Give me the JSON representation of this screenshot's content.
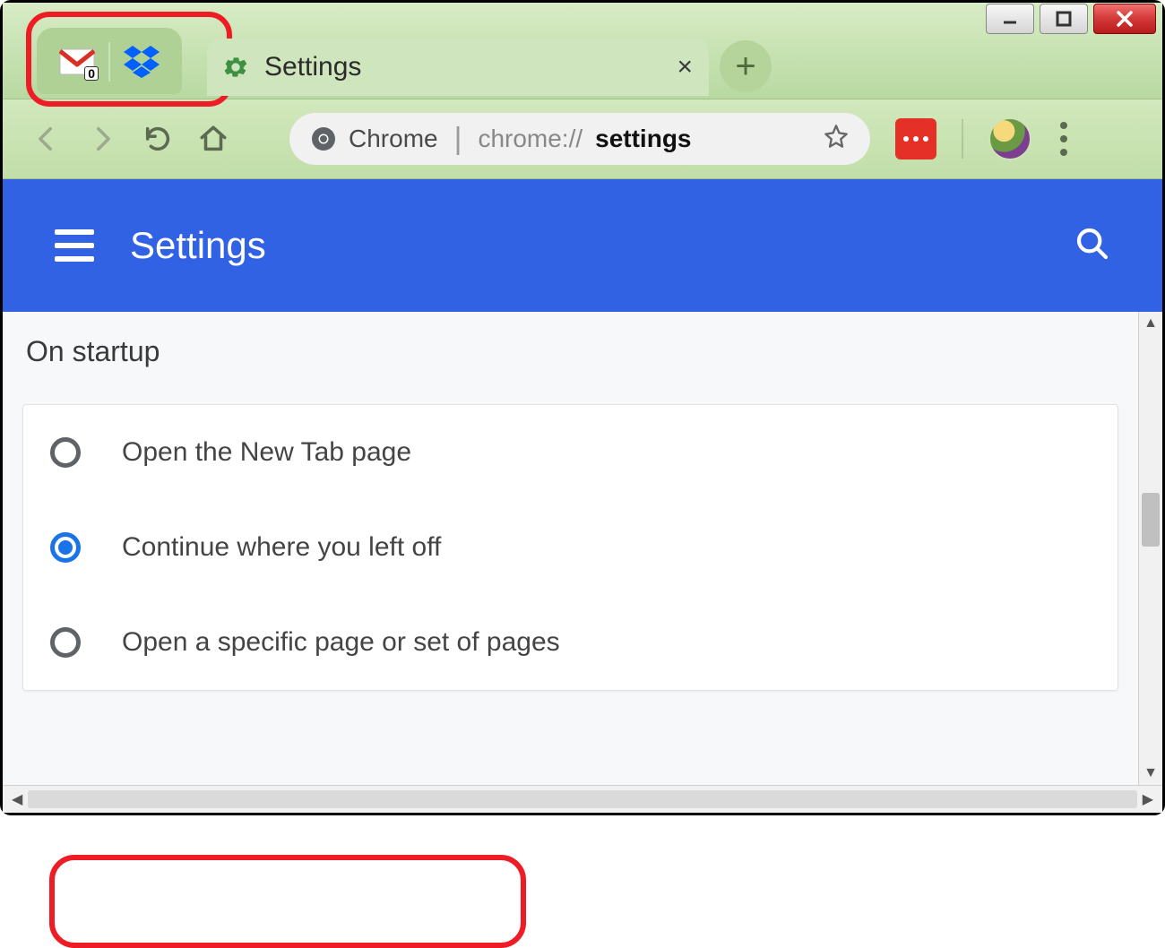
{
  "window": {
    "minimize_name": "minimize",
    "maximize_name": "maximize",
    "close_name": "close"
  },
  "pinned_tabs": {
    "gmail_badge": "0"
  },
  "active_tab": {
    "title": "Settings"
  },
  "omnibox": {
    "product": "Chrome",
    "url_prefix": "chrome://",
    "url_bold": "settings"
  },
  "settings_header": {
    "title": "Settings"
  },
  "section": {
    "title": "On startup",
    "options": [
      {
        "label": "Open the New Tab page",
        "checked": false
      },
      {
        "label": "Continue where you left off",
        "checked": true
      },
      {
        "label": "Open a specific page or set of pages",
        "checked": false
      }
    ]
  }
}
